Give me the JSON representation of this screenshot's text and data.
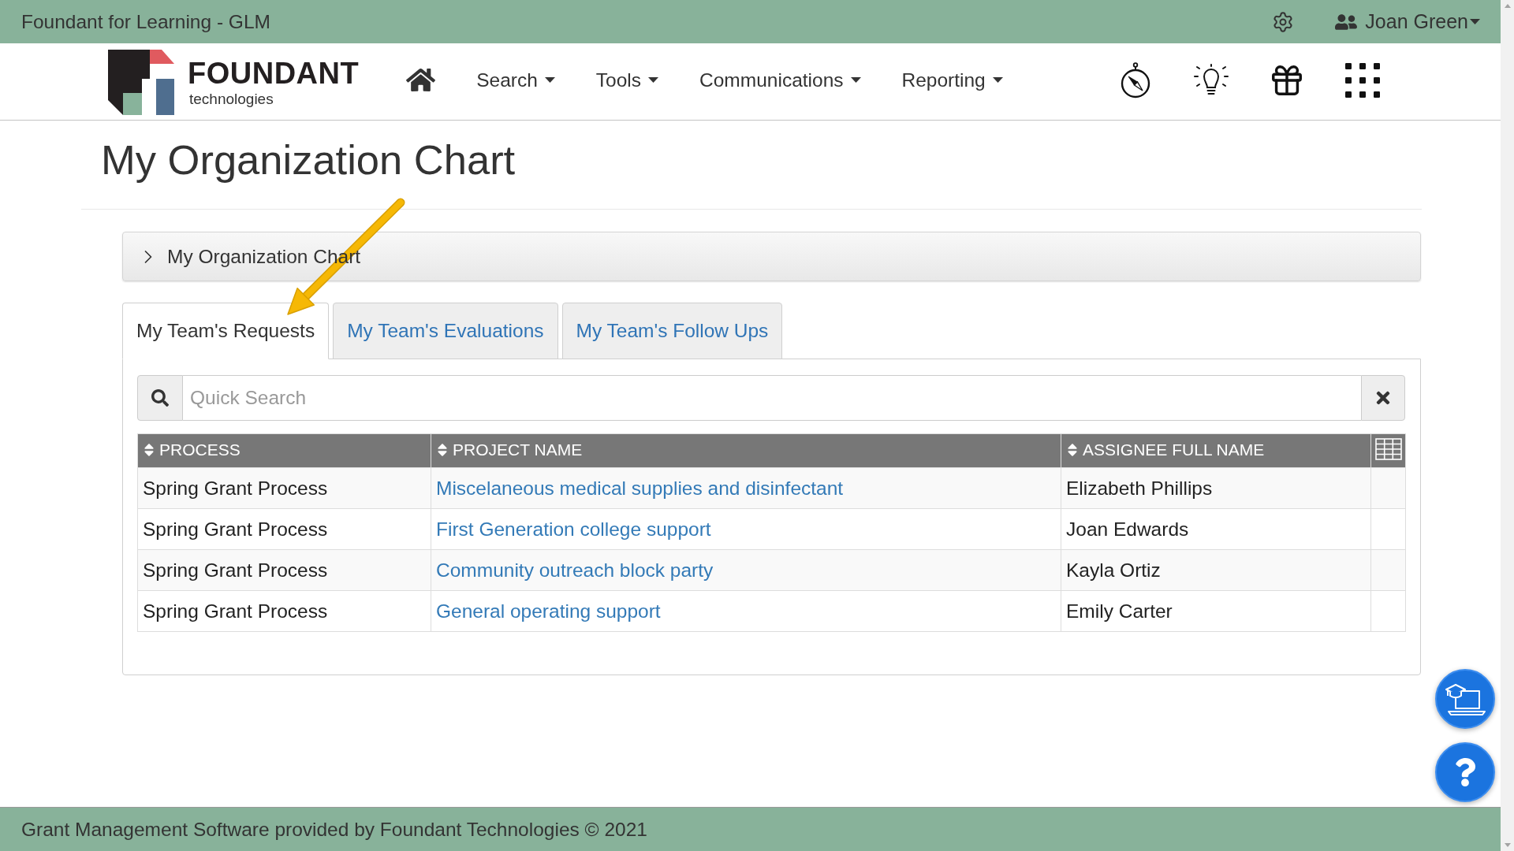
{
  "top_bar": {
    "title": "Foundant for Learning - GLM",
    "user_name": "Joan Green"
  },
  "logo": {
    "name": "FOUNDANT",
    "tagline": "technologies"
  },
  "nav": {
    "items": [
      {
        "label": "Search"
      },
      {
        "label": "Tools"
      },
      {
        "label": "Communications"
      },
      {
        "label": "Reporting"
      }
    ]
  },
  "page": {
    "title": "My Organization Chart"
  },
  "accordion": {
    "label": "My Organization Chart",
    "expanded": false
  },
  "tabs": [
    {
      "label": "My Team's Requests",
      "selected": true
    },
    {
      "label": "My Team's Evaluations",
      "selected": false
    },
    {
      "label": "My Team's Follow Ups",
      "selected": false
    }
  ],
  "search": {
    "placeholder": "Quick Search"
  },
  "table": {
    "columns": [
      {
        "label": "PROCESS"
      },
      {
        "label": "PROJECT NAME"
      },
      {
        "label": "ASSIGNEE FULL NAME"
      }
    ],
    "rows": [
      {
        "process": "Spring Grant Process",
        "project_name": "Miscelaneous medical supplies and disinfectant",
        "assignee_full_name": "Elizabeth Phillips"
      },
      {
        "process": "Spring Grant Process",
        "project_name": "First Generation college support",
        "assignee_full_name": "Joan Edwards"
      },
      {
        "process": "Spring Grant Process",
        "project_name": "Community outreach block party",
        "assignee_full_name": "Kayla Ortiz"
      },
      {
        "process": "Spring Grant Process",
        "project_name": "General operating support",
        "assignee_full_name": "Emily Carter"
      }
    ]
  },
  "footer": {
    "text": "Grant Management Software provided by Foundant Technologies © 2021"
  }
}
